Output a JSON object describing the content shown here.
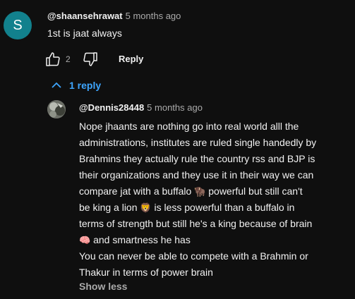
{
  "comment": {
    "avatar_letter": "S",
    "author": "@shaansehrawat",
    "time": "5 months ago",
    "text": "1st is jaat always",
    "likes": "2",
    "reply_label": "Reply",
    "replies_toggle": "1 reply"
  },
  "reply": {
    "author": "@Dennis28448",
    "time": "5 months ago",
    "lines": {
      "l1": "Nope jhaants are nothing go into real world alll the",
      "l2": "administrations, institutes are ruled single handedly by",
      "l3": "Brahmins they actually rule the country rss and BJP is",
      "l4": "their organizations and they use it in their way we can",
      "l5a": "compare jat with a buffalo ",
      "l5e": "🦬",
      "l5b": " powerful but still can't",
      "l6a": "be king a lion ",
      "l6e": "🦁",
      "l6b": " is less powerful than a buffalo in",
      "l7": "terms of strength but still he's a king because of brain",
      "l8e": "🧠",
      "l8b": " and smartness he has",
      "l9": "You can never be able to compete with a Brahmin or",
      "l10": "Thakur in terms of power brain"
    },
    "show_less": "Show less"
  },
  "colors": {
    "background": "#0f0f0f",
    "avatar": "#12818d",
    "link_blue": "#3ea6ff",
    "muted": "#aaaaaa"
  },
  "icons": [
    "thumbs-up-icon",
    "thumbs-down-icon",
    "chevron-up-icon"
  ]
}
